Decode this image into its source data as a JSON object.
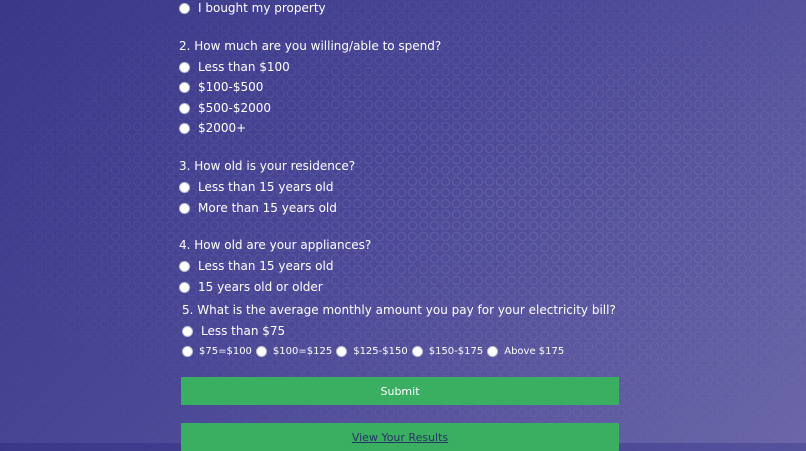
{
  "q1": {
    "options": [
      "I bought my property"
    ]
  },
  "q2": {
    "question": "2. How much are you willing/able to spend?",
    "options": [
      "Less than $100",
      "$100-$500",
      "$500-$2000",
      "$2000+"
    ]
  },
  "q3": {
    "question": "3. How old is your residence?",
    "options": [
      "Less than 15 years old",
      "More than 15 years old"
    ]
  },
  "q4": {
    "question": "4. How old are your appliances?",
    "options": [
      "Less than 15 years old",
      "15 years old or older"
    ]
  },
  "q5": {
    "question": "5. What is the average monthly amount you pay for your electricity bill?",
    "option_first": "Less than $75",
    "inline_options": [
      "$75=$100",
      "$100=$125",
      "$125-$150",
      "$150-$175",
      "Above $175"
    ]
  },
  "buttons": {
    "submit": "Submit",
    "view_results": "View Your Results"
  },
  "colors": {
    "button_green": "#3aaf62",
    "background": "#3a3789"
  }
}
